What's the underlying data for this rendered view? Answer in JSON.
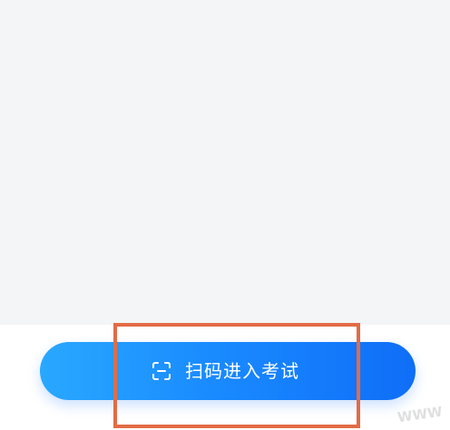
{
  "main": {
    "action_button": {
      "label": "扫码进入考试",
      "icon": "scan-icon"
    }
  },
  "watermark": {
    "text": "WWW"
  },
  "colors": {
    "background_top": "#f4f5f7",
    "button_start": "#29a8ff",
    "button_end": "#0f6ef7",
    "highlight_border": "#e36b46"
  }
}
